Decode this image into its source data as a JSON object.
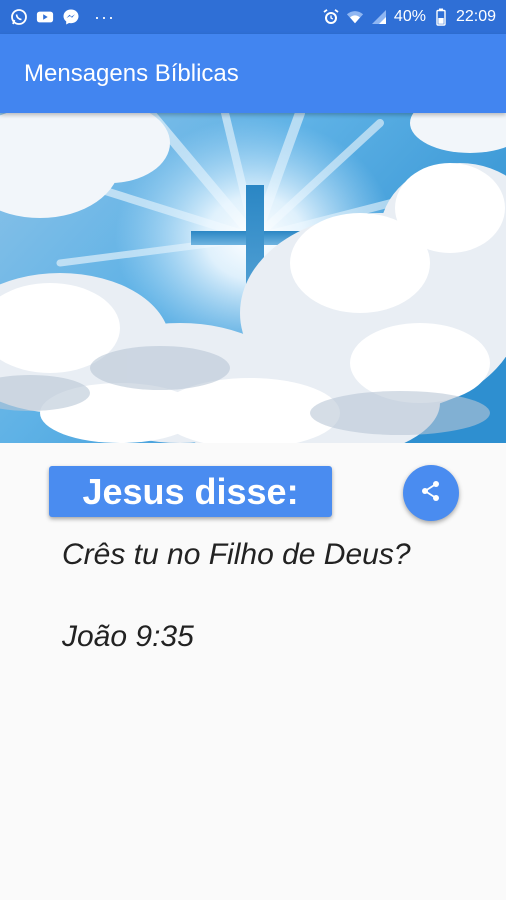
{
  "status_bar": {
    "battery": "40%",
    "time": "22:09",
    "left_icons": [
      "whatsapp-icon",
      "youtube-icon",
      "messenger-icon"
    ],
    "more": "···",
    "right_icons": [
      "alarm-icon",
      "wifi-icon",
      "signal-icon",
      "battery-icon"
    ]
  },
  "app_bar": {
    "title": "Mensagens Bíblicas"
  },
  "hero": {
    "description_icon": "cross-in-clouds-image"
  },
  "message": {
    "label": "Jesus disse:",
    "text": "Crês tu no Filho de Deus?",
    "reference": "João 9:35"
  },
  "actions": {
    "share_icon": "share-icon"
  },
  "colors": {
    "status_bar": "#2f6fd6",
    "app_bar": "#4285f0",
    "accent": "#4a8cf0",
    "background": "#fafafa",
    "text": "#222222"
  }
}
